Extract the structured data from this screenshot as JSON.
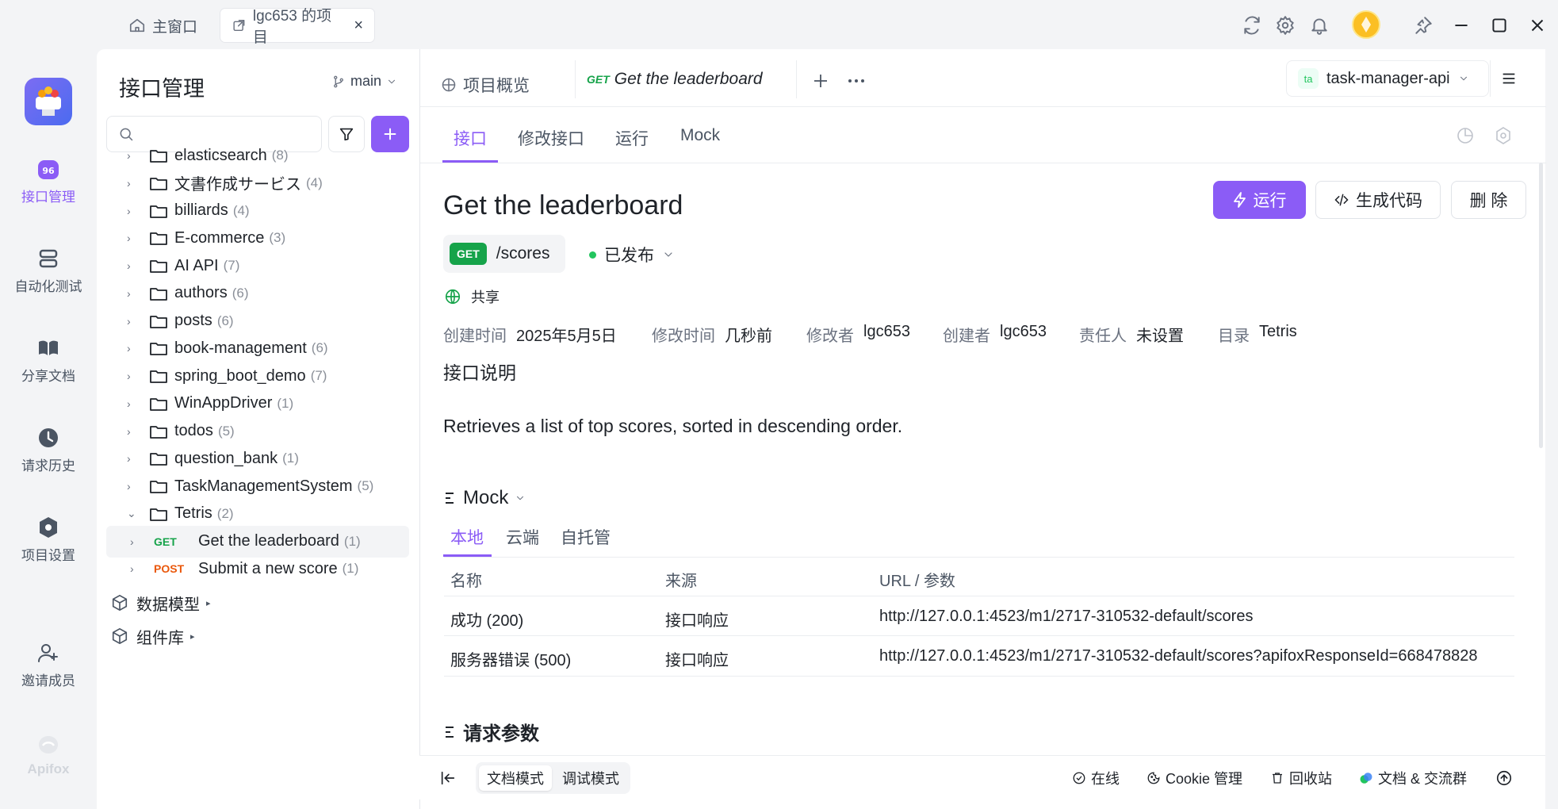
{
  "window": {
    "tabs": [
      {
        "label": "主窗口",
        "icon": "home-icon"
      },
      {
        "label": "lgc653 的项目",
        "icon": "external-link-icon"
      }
    ],
    "controls": [
      "refresh-icon",
      "settings-icon",
      "bell-icon",
      "avatar",
      "pin-icon",
      "minimize-icon",
      "maximize-icon",
      "close-icon"
    ]
  },
  "rail": {
    "items": [
      {
        "label": "接口管理",
        "icon": "api-management-icon"
      },
      {
        "label": "自动化测试",
        "icon": "automation-test-icon"
      },
      {
        "label": "分享文档",
        "icon": "share-doc-icon"
      },
      {
        "label": "请求历史",
        "icon": "history-icon"
      },
      {
        "label": "项目设置",
        "icon": "project-settings-icon"
      },
      {
        "label": "邀请成员",
        "icon": "invite-member-icon"
      }
    ],
    "brand": "Apifox",
    "active_color": "#8b5cf6"
  },
  "sidebar": {
    "title": "接口管理",
    "branch": "main",
    "search_placeholder": "",
    "folders": [
      {
        "name": "elasticsearch",
        "count": "(8)"
      },
      {
        "name": "文書作成サービス",
        "count": "(4)"
      },
      {
        "name": "billiards",
        "count": "(4)"
      },
      {
        "name": "E-commerce",
        "count": "(3)"
      },
      {
        "name": "AI API",
        "count": "(7)"
      },
      {
        "name": "authors",
        "count": "(6)"
      },
      {
        "name": "posts",
        "count": "(6)"
      },
      {
        "name": "book-management",
        "count": "(6)"
      },
      {
        "name": "spring_boot_demo",
        "count": "(7)"
      },
      {
        "name": "WinAppDriver",
        "count": "(1)"
      },
      {
        "name": "todos",
        "count": "(5)"
      },
      {
        "name": "question_bank",
        "count": "(1)"
      },
      {
        "name": "TaskManagementSystem",
        "count": "(5)"
      },
      {
        "name": "Tetris",
        "count": "(2)"
      }
    ],
    "endpoints": [
      {
        "method": "GET",
        "name": "Get the leaderboard",
        "count": "(1)"
      },
      {
        "method": "POST",
        "name": "Submit a new score",
        "count": "(1)"
      }
    ],
    "extra": [
      {
        "label": "数据模型"
      },
      {
        "label": "组件库"
      }
    ]
  },
  "main": {
    "doc_tabs": [
      {
        "label": "项目概览",
        "method": ""
      },
      {
        "label": "Get the leaderboard",
        "method": "GET"
      }
    ],
    "env": {
      "badge": "ta",
      "name": "task-manager-api"
    },
    "sub_tabs": [
      "接口",
      "修改接口",
      "运行",
      "Mock"
    ],
    "title": "Get the leaderboard",
    "method": "GET",
    "path": "/scores",
    "status": "已发布",
    "shared": "共享",
    "buttons": {
      "run": "运行",
      "gen_code": "生成代码",
      "delete": "删 除"
    },
    "meta": [
      {
        "key": "创建时间",
        "value": "2025年5月5日"
      },
      {
        "key": "修改时间",
        "value": "几秒前"
      },
      {
        "key": "修改者",
        "value": "lgc653"
      },
      {
        "key": "创建者",
        "value": "lgc653"
      },
      {
        "key": "责任人",
        "value": "未设置"
      },
      {
        "key": "目录",
        "value": "Tetris"
      }
    ],
    "desc_heading": "接口说明",
    "description": "Retrieves a list of top scores, sorted in descending order.",
    "mock": {
      "heading": "Mock",
      "tabs": [
        "本地",
        "云端",
        "自托管"
      ],
      "columns": [
        "名称",
        "来源",
        "URL / 参数"
      ],
      "rows": [
        {
          "name": "成功 (200)",
          "source": "接口响应",
          "url": "http://127.0.0.1:4523/m1/2717-310532-default/scores"
        },
        {
          "name": "服务器错误 (500)",
          "source": "接口响应",
          "url": "http://127.0.0.1:4523/m1/2717-310532-default/scores?apifoxResponseId=668478828"
        }
      ]
    },
    "params_heading": "请求参数"
  },
  "statusbar": {
    "modes": [
      "文档模式",
      "调试模式"
    ],
    "items": [
      {
        "label": "在线",
        "icon": "online-icon"
      },
      {
        "label": "Cookie 管理",
        "icon": "cookie-icon"
      },
      {
        "label": "回收站",
        "icon": "trash-icon"
      },
      {
        "label": "文档 & 交流群",
        "icon": "community-icon"
      }
    ]
  },
  "colors": {
    "accent": "#8b5cf6",
    "get": "#16a34a",
    "post": "#ea580c",
    "published": "#22c55e"
  }
}
